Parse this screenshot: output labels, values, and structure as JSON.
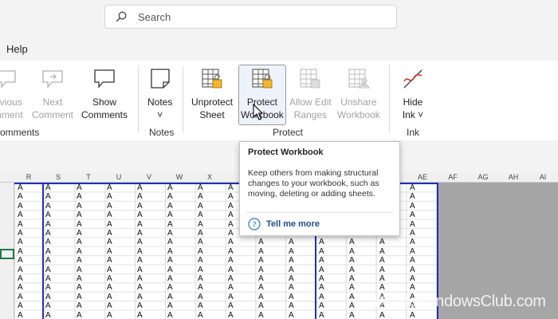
{
  "search": {
    "placeholder": "Search"
  },
  "menu": {
    "help": "Help"
  },
  "ribbon": {
    "buttons": [
      {
        "line1": "evious",
        "line2": "mment",
        "disabled": true
      },
      {
        "line1": "Next",
        "line2": "Comment",
        "disabled": true
      },
      {
        "line1": "Show",
        "line2": "Comments",
        "disabled": false
      },
      {
        "line1": "Notes",
        "line2": "˅",
        "disabled": false
      },
      {
        "line1": "Unprotect",
        "line2": "Sheet",
        "disabled": false
      },
      {
        "line1": "Protect",
        "line2": "Workbook",
        "disabled": false
      },
      {
        "line1": "Allow Edit",
        "line2": "Ranges",
        "disabled": true
      },
      {
        "line1": "Unshare",
        "line2": "Workbook",
        "disabled": true
      },
      {
        "line1": "Hide",
        "line2": "Ink ˅",
        "disabled": false
      }
    ],
    "groups": {
      "comments": "omments",
      "notes": "Notes",
      "protect": "Protect",
      "ink": "Ink"
    }
  },
  "sheet": {
    "columns": [
      "R",
      "S",
      "T",
      "U",
      "V",
      "W",
      "X",
      "AE",
      "AF",
      "AG",
      "AH",
      "AI"
    ],
    "cell_value": "A"
  },
  "tooltip": {
    "title": "Protect Workbook",
    "body": "Keep others from making structural changes to your workbook, such as moving, deleting or adding sheets.",
    "link": "Tell me more"
  },
  "watermark": {
    "text": "TheWindowsClub.com"
  },
  "colors": {
    "accent_blue": "#2030b8",
    "selection_green": "#1f7a45",
    "link": "#1f4e8c"
  }
}
